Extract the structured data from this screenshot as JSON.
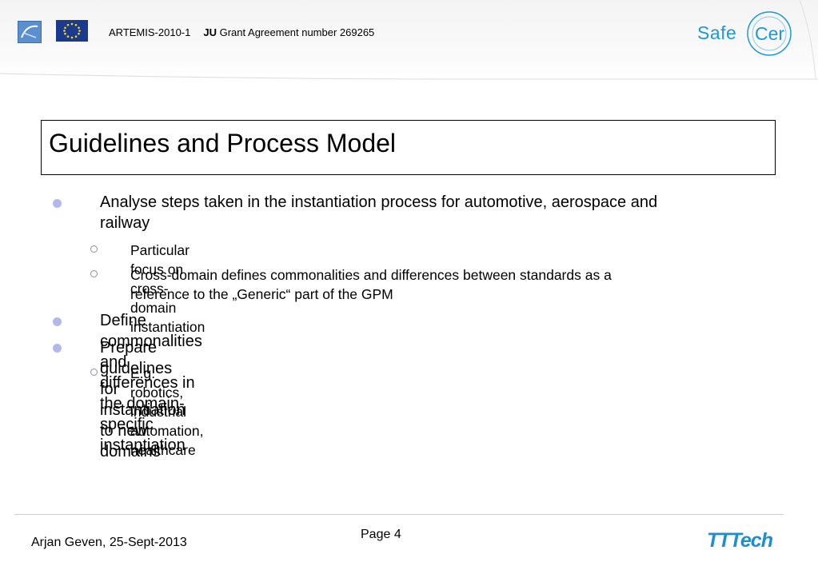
{
  "header": {
    "program": "ARTEMIS-2010-1",
    "ju": "JU",
    "grant": "Grant Agreement number 269265",
    "logo_left_text": "ARTEMIS",
    "brand_safe": "Safe",
    "brand_cer": "Cer",
    "colors": {
      "brand_blue": "#1b9ad6",
      "eu_blue": "#1a3a8f",
      "eu_star": "#ffd800"
    }
  },
  "slide": {
    "title": "Guidelines and Process Model",
    "bullets": [
      {
        "text_line1": "Analyse steps taken in the instantiation process for automotive, aerospace and",
        "text_line2": "railway"
      },
      {
        "text": "Particular focus on cross-domain instantiation"
      },
      {
        "text_line1": "Cross-domain defines commonalities and differences between standards as a",
        "text_line2": "reference to the „Generic“ part of the GPM"
      },
      {
        "text": "Define commonalities and differences in the domain-specific instantiation"
      },
      {
        "text": "Prepare guidelines for instantiation to new domains"
      },
      {
        "text": "E.g. robotics, industrial automation, healthcare"
      }
    ],
    "colors": {
      "bullet_fill": "#b3b8ec",
      "bullet_outline": "#8c8cb0"
    }
  },
  "footer": {
    "author": "Arjan Geven, 25-Sept-2013",
    "page": "Page 4",
    "logo": "TTTech"
  }
}
